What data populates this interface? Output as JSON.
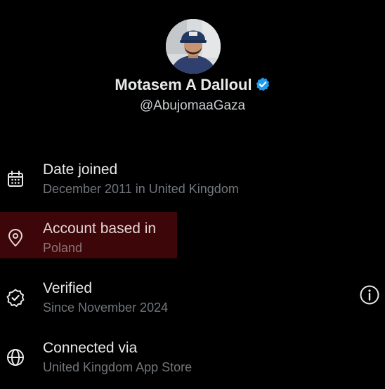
{
  "profile": {
    "display_name": "Motasem A Dalloul",
    "handle": "@AbujomaaGaza",
    "verified_icon": "verified-badge-icon",
    "badge_color": "#1d9bf0"
  },
  "about": {
    "rows": [
      {
        "icon": "calendar-icon",
        "title": "Date joined",
        "subtitle": "December 2011 in United Kingdom"
      },
      {
        "icon": "location-pin-icon",
        "title": "Account based in",
        "subtitle": "Poland",
        "highlight_color": "#3d0608"
      },
      {
        "icon": "verified-seal-icon",
        "title": "Verified",
        "subtitle": "Since November 2024",
        "trailing_icon": "info-icon"
      },
      {
        "icon": "globe-icon",
        "title": "Connected via",
        "subtitle": "United Kingdom App Store"
      }
    ]
  }
}
